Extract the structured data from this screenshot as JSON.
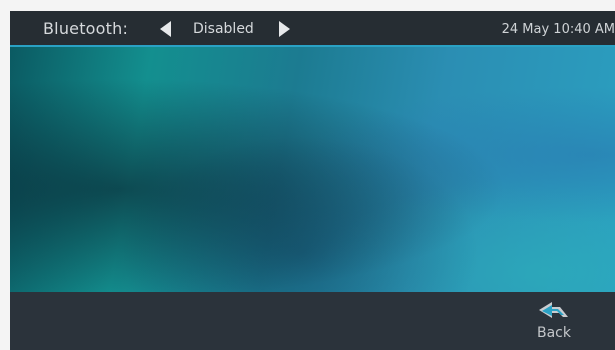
{
  "status_bar": {
    "setting_label": "Bluetooth:",
    "setting_value": "Disabled",
    "datetime": "24 May 10:40 AM",
    "prev_icon": "left-triangle-icon",
    "next_icon": "right-triangle-icon"
  },
  "softkey": {
    "back_label": "Back",
    "back_icon": "back-arrow-icon"
  },
  "colors": {
    "accent": "#2aa1c4",
    "bar_background": "#262d33"
  }
}
